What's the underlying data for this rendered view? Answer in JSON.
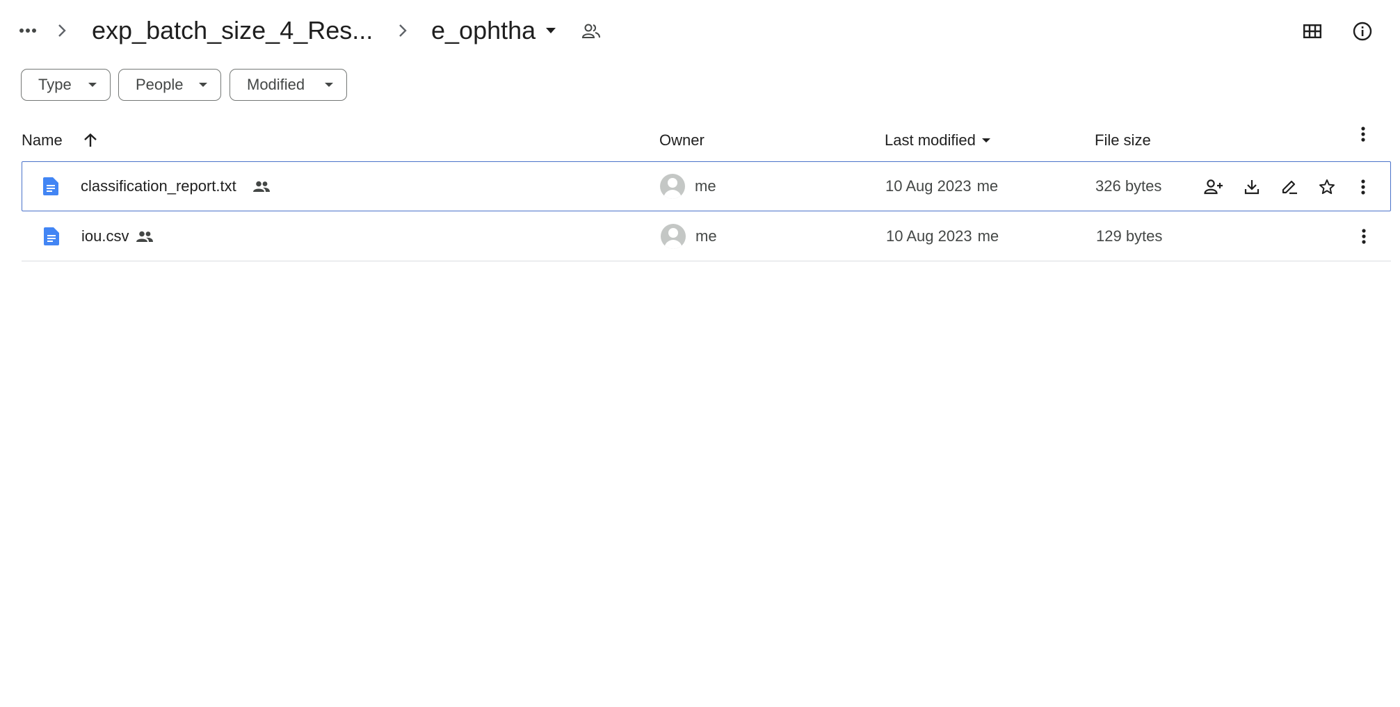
{
  "breadcrumb": {
    "more_label": "•••",
    "parent_folder": "exp_batch_size_4_Res...",
    "current_folder": "e_ophtha"
  },
  "filters": [
    {
      "label": "Type"
    },
    {
      "label": "People"
    },
    {
      "label": "Modified"
    }
  ],
  "table": {
    "columns": {
      "name": "Name",
      "owner": "Owner",
      "last_modified": "Last modified",
      "file_size": "File size"
    },
    "sort": {
      "column": "name",
      "direction": "ascending"
    },
    "rows": [
      {
        "name": "classification_report.txt",
        "shared": true,
        "owner": "me",
        "modified_date": "10 Aug 2023",
        "modified_by": "me",
        "size": "326 bytes",
        "selected": true
      },
      {
        "name": "iou.csv",
        "shared": true,
        "owner": "me",
        "modified_date": "10 Aug 2023",
        "modified_by": "me",
        "size": "129 bytes",
        "selected": false
      }
    ]
  },
  "colors": {
    "doc_icon": "#4285f4",
    "selection_border": "#4a72c9",
    "divider": "#dadce0"
  }
}
